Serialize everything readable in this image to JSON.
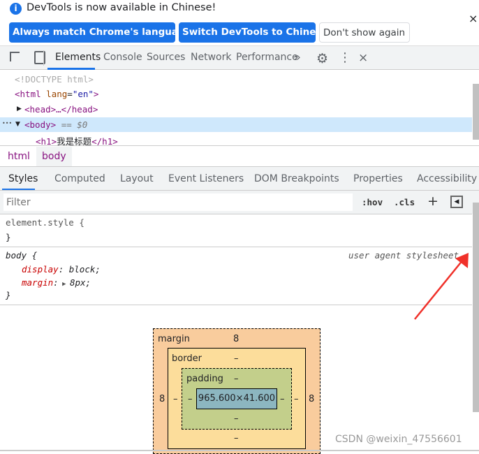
{
  "infobar": {
    "message": "DevTools is now available in Chinese!",
    "buttons": [
      "Always match Chrome's language",
      "Switch DevTools to Chinese",
      "Don't show again"
    ],
    "close": "×"
  },
  "toolbar": {
    "tabs": [
      "Elements",
      "Console",
      "Sources",
      "Network",
      "Performance"
    ],
    "more": "»",
    "close": "×"
  },
  "dom": {
    "doctype": "<!DOCTYPE html>",
    "html_open": "<html",
    "lang_attr": "lang",
    "lang_val": "\"en\"",
    "head": "<head>…</head>",
    "body": "<body>",
    "body_marker": "== $0",
    "h1_open": "<h1>",
    "h1_text": "我是标题",
    "h1_close": "</h1>",
    "html_close_bracket": ">",
    "ellipsis": "•••"
  },
  "breadcrumb": [
    "html",
    "body"
  ],
  "subtabs": [
    "Styles",
    "Computed",
    "Layout",
    "Event Listeners",
    "DOM Breakpoints",
    "Properties",
    "Accessibility"
  ],
  "filter": {
    "placeholder": "Filter",
    "hov": ":hov",
    "cls": ".cls",
    "plus": "+"
  },
  "rules": {
    "element_style": "element.style {",
    "close": "}",
    "body_selector": "body {",
    "source": "user agent stylesheet",
    "display_prop": "display",
    "display_val": "block;",
    "margin_prop": "margin",
    "margin_val": "8px;"
  },
  "boxmodel": {
    "margin_label": "margin",
    "margin_top": "8",
    "margin_left": "8",
    "margin_right": "8",
    "border_label": "border",
    "border_top": "–",
    "border_left": "–",
    "border_right": "–",
    "border_bottom": "–",
    "padding_label": "padding",
    "padding_top": "–",
    "padding_left": "–",
    "padding_right": "–",
    "padding_bottom": "–",
    "content": "965.600×41.600"
  },
  "watermark": "CSDN @weixin_47556601",
  "colors": {
    "accent": "#1a73e8",
    "margin": "#f9cc9d",
    "border": "#fcdd9b",
    "padding": "#c3cf8b",
    "content": "#8cb6c0",
    "arrow": "#f0312a"
  }
}
